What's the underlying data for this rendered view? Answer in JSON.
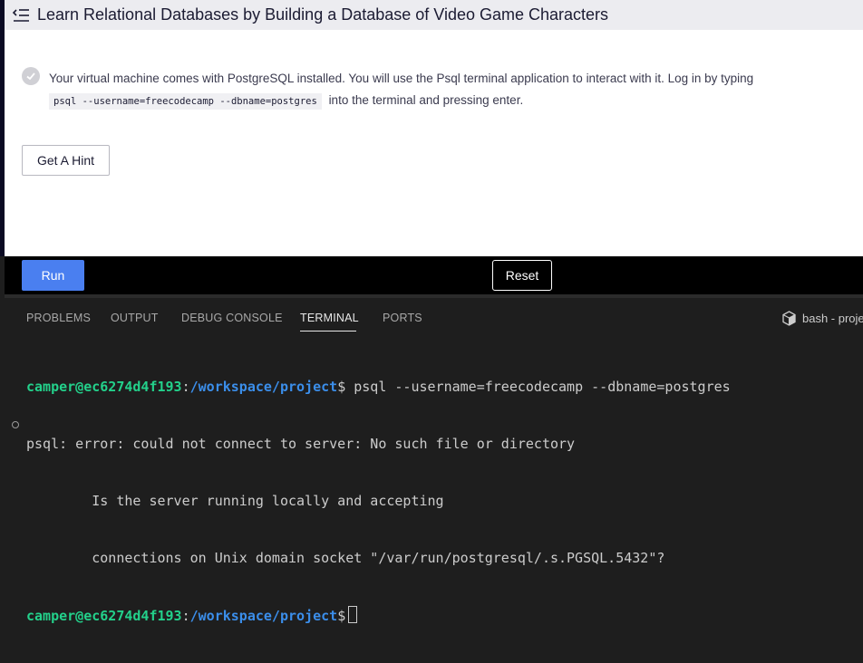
{
  "header": {
    "title": "Learn Relational Databases by Building a Database of Video Game Characters"
  },
  "task": {
    "text_before": "Your virtual machine comes with PostgreSQL installed. You will use the Psql terminal application to interact with it. Log in by typing",
    "code": "psql --username=freecodecamp --dbname=postgres",
    "text_after": "into the terminal and pressing enter."
  },
  "buttons": {
    "hint": "Get A Hint",
    "run": "Run",
    "reset": "Reset"
  },
  "panel": {
    "tabs": [
      "PROBLEMS",
      "OUTPUT",
      "DEBUG CONSOLE",
      "TERMINAL",
      "PORTS"
    ],
    "active_tab": "TERMINAL",
    "shell_label": "bash - proje"
  },
  "terminal": {
    "user": "camper@ec6274d4f193",
    "colon": ":",
    "path": "/workspace/project",
    "prompt_symbol": "$",
    "command": " psql --username=freecodecamp --dbname=postgres",
    "output": [
      "psql: error: could not connect to server: No such file or directory",
      "        Is the server running locally and accepting",
      "        connections on Unix domain socket \"/var/run/postgresql/.s.PGSQL.5432\"?"
    ]
  },
  "colors": {
    "accent": "#4a7ff0",
    "prompt_user": "#23d18b",
    "prompt_path": "#3b8eea"
  }
}
